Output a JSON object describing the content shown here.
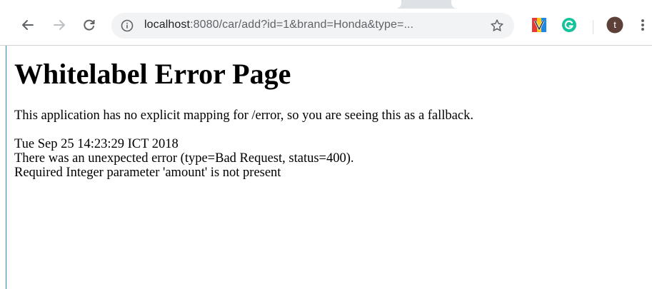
{
  "browser": {
    "url_host": "localhost",
    "url_rest": ":8080/car/add?id=1&brand=Honda&type=...",
    "profile_initial": "t"
  },
  "page": {
    "title": "Whitelabel Error Page",
    "message": "This application has no explicit mapping for /error, so you are seeing this as a fallback.",
    "timestamp": "Tue Sep 25 14:23:29 ICT 2018",
    "error_line": "There was an unexpected error (type=Bad Request, status=400).",
    "detail_line": "Required Integer parameter 'amount' is not present"
  },
  "colors": {
    "accent_border": "#2b8ab8",
    "grammarly": "#15c39a",
    "profile_avatar": "#5d4037"
  },
  "icons": {
    "back": "back-arrow-icon",
    "forward": "forward-arrow-icon",
    "reload": "reload-icon",
    "info": "info-icon",
    "bookmark": "bookmark-star-icon",
    "ext1": "vivaldi-extension-icon",
    "ext2": "grammarly-extension-icon",
    "menu": "more-vert-icon"
  }
}
